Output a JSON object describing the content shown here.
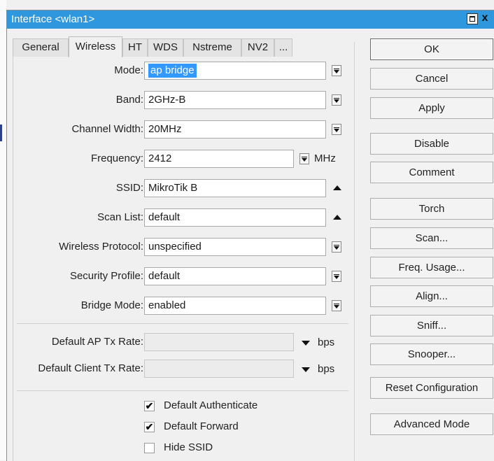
{
  "window": {
    "title": "Interface <wlan1>",
    "maximize_icon": "maximize-icon",
    "close_label": "x"
  },
  "tabs": [
    "General",
    "Wireless",
    "HT",
    "WDS",
    "Nstreme",
    "NV2",
    "..."
  ],
  "active_tab": "Wireless",
  "fields": {
    "mode": {
      "label": "Mode:",
      "value": "ap bridge"
    },
    "band": {
      "label": "Band:",
      "value": "2GHz-B"
    },
    "channel_width": {
      "label": "Channel Width:",
      "value": "20MHz"
    },
    "frequency": {
      "label": "Frequency:",
      "value": "2412",
      "unit": "MHz"
    },
    "ssid": {
      "label": "SSID:",
      "value": "MikroTik B"
    },
    "scan_list": {
      "label": "Scan List:",
      "value": "default"
    },
    "wireless_protocol": {
      "label": "Wireless Protocol:",
      "value": "unspecified"
    },
    "security_profile": {
      "label": "Security Profile:",
      "value": "default"
    },
    "bridge_mode": {
      "label": "Bridge Mode:",
      "value": "enabled"
    },
    "default_ap_tx_rate": {
      "label": "Default AP Tx Rate:",
      "value": "",
      "unit": "bps"
    },
    "default_client_tx_rate": {
      "label": "Default Client Tx Rate:",
      "value": "",
      "unit": "bps"
    }
  },
  "checkboxes": [
    {
      "label": "Default Authenticate",
      "checked": true,
      "mark": "✔"
    },
    {
      "label": "Default Forward",
      "checked": true,
      "mark": "✔"
    },
    {
      "label": "Hide SSID",
      "checked": false,
      "mark": ""
    }
  ],
  "buttons": {
    "ok": "OK",
    "cancel": "Cancel",
    "apply": "Apply",
    "disable": "Disable",
    "comment": "Comment",
    "torch": "Torch",
    "scan": "Scan...",
    "freq_usage": "Freq. Usage...",
    "align": "Align...",
    "sniff": "Sniff...",
    "snooper": "Snooper...",
    "reset_configuration": "Reset Configuration",
    "advanced_mode": "Advanced Mode"
  },
  "colors": {
    "titlebar": "#2f97dd",
    "selection": "#3399ff"
  }
}
